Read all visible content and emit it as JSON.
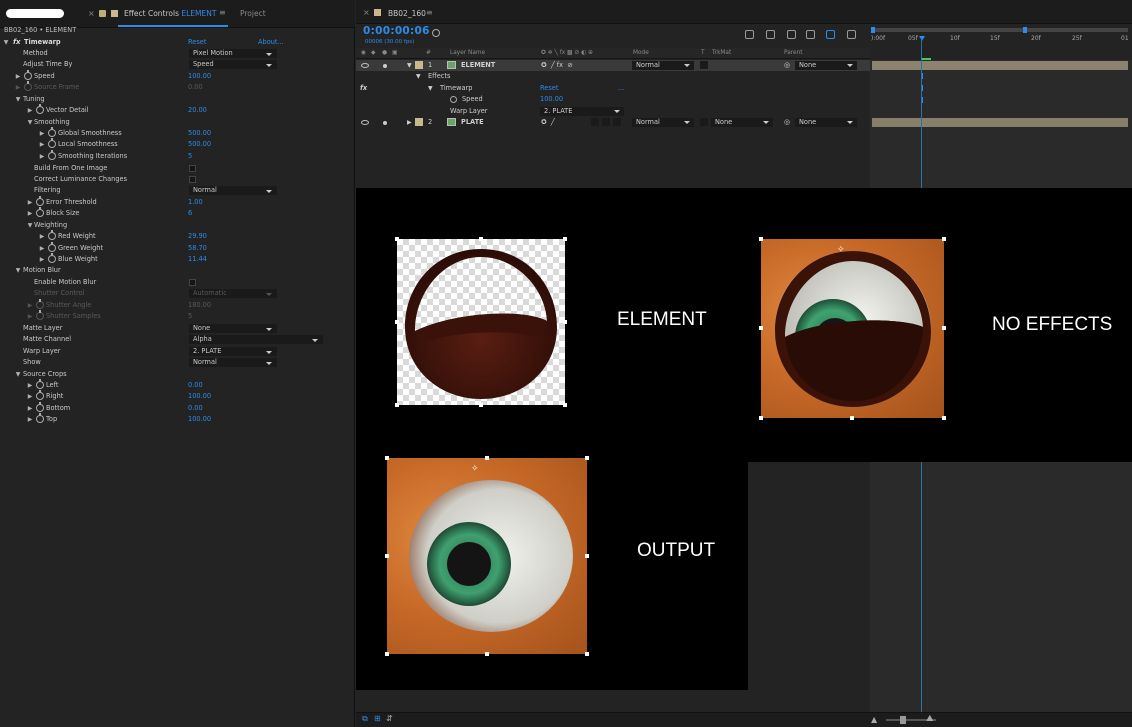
{
  "effect_controls": {
    "tab_label": "Effect Controls",
    "tab_accent": "ELEMENT",
    "tab_project": "Project",
    "subtitle": "BB02_160 • ELEMENT",
    "effect_name": "Timewarp",
    "reset": "Reset",
    "about": "About...",
    "rows": {
      "method": {
        "label": "Method",
        "value": "Pixel Motion"
      },
      "adjust_time_by": {
        "label": "Adjust Time By",
        "value": "Speed"
      },
      "speed": {
        "label": "Speed",
        "value": "100.00"
      },
      "source_frame": {
        "label": "Source Frame",
        "value": "0.00"
      },
      "tuning": {
        "label": "Tuning"
      },
      "vector_detail": {
        "label": "Vector Detail",
        "value": "20.00"
      },
      "smoothing": {
        "label": "Smoothing"
      },
      "global_smoothness": {
        "label": "Global Smoothness",
        "value": "500.00"
      },
      "local_smoothness": {
        "label": "Local Smoothness",
        "value": "500.00"
      },
      "smoothing_iterations": {
        "label": "Smoothing Iterations",
        "value": "5"
      },
      "build_from_one_image": {
        "label": "Build From One Image"
      },
      "correct_luminance": {
        "label": "Correct Luminance Changes"
      },
      "filtering": {
        "label": "Filtering",
        "value": "Normal"
      },
      "error_threshold": {
        "label": "Error Threshold",
        "value": "1.00"
      },
      "block_size": {
        "label": "Block Size",
        "value": "6"
      },
      "weighting": {
        "label": "Weighting"
      },
      "red_weight": {
        "label": "Red Weight",
        "value": "29.90"
      },
      "green_weight": {
        "label": "Green Weight",
        "value": "58.70"
      },
      "blue_weight": {
        "label": "Blue Weight",
        "value": "11.44"
      },
      "motion_blur": {
        "label": "Motion Blur"
      },
      "enable_motion_blur": {
        "label": "Enable Motion Blur"
      },
      "shutter_control": {
        "label": "Shutter Control",
        "value": "Automatic"
      },
      "shutter_angle": {
        "label": "Shutter Angle",
        "value": "180.00"
      },
      "shutter_samples": {
        "label": "Shutter Samples",
        "value": "5"
      },
      "matte_layer": {
        "label": "Matte Layer",
        "value": "None"
      },
      "matte_channel": {
        "label": "Matte Channel",
        "value": "Alpha"
      },
      "warp_layer": {
        "label": "Warp Layer",
        "value": "2. PLATE"
      },
      "show": {
        "label": "Show",
        "value": "Normal"
      },
      "source_crops": {
        "label": "Source Crops"
      },
      "left": {
        "label": "Left",
        "value": "0.00"
      },
      "right": {
        "label": "Right",
        "value": "100.00"
      },
      "bottom": {
        "label": "Bottom",
        "value": "0.00"
      },
      "top": {
        "label": "Top",
        "value": "100.00"
      }
    }
  },
  "timeline": {
    "comp_tab": "BB02_160",
    "timecode": "0:00:00:06",
    "fps": "00006 (30.00 fps)",
    "columns": {
      "number": "#",
      "layer_name": "Layer Name",
      "mode": "Mode",
      "t": "T",
      "trkmat": "TrkMat",
      "parent": "Parent"
    },
    "ruler_labels": [
      "):00f",
      "05f",
      "10f",
      "15f",
      "20f",
      "25f",
      "01"
    ],
    "layers": [
      {
        "number": "1",
        "name": "ELEMENT",
        "mode": "Normal",
        "parent": "None"
      },
      {
        "number": "2",
        "name": "PLATE",
        "mode": "Normal",
        "trkmat": "None",
        "parent": "None"
      }
    ],
    "effects_label": "Effects",
    "timewarp_label": "Timewarp",
    "timewarp_reset": "Reset",
    "timewarp_more": "...",
    "speed_label": "Speed",
    "speed_value": "100.00",
    "warp_layer_label": "Warp Layer",
    "warp_layer_value": "2. PLATE"
  },
  "comparison": {
    "captions": {
      "element": "ELEMENT",
      "no_effects": "NO EFFECTS",
      "output": "OUTPUT"
    }
  },
  "colors": {
    "accent": "#2d8ceb",
    "panel_bg": "#232323",
    "layer_tan": "#c8b88c"
  }
}
